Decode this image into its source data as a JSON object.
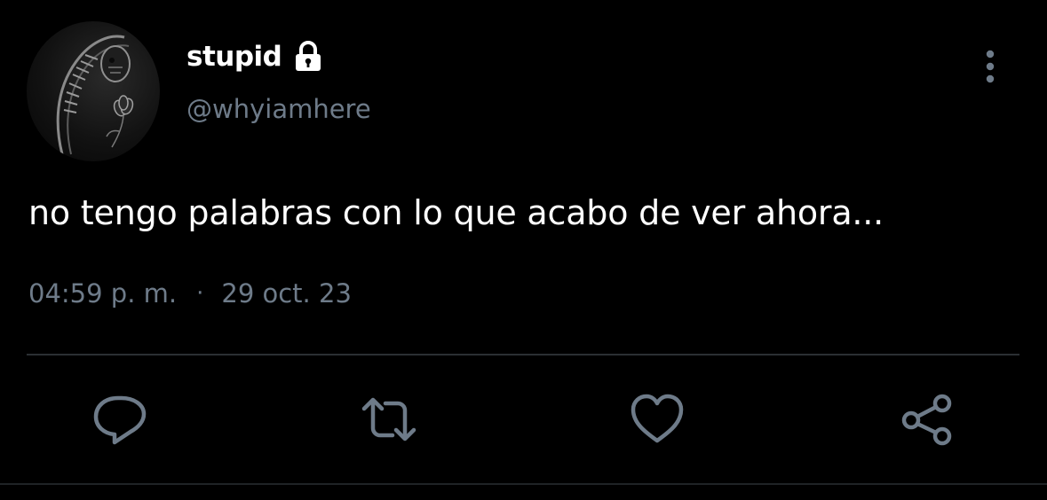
{
  "author": {
    "display_name": "stupid",
    "handle": "@whyiamhere",
    "protected_icon": "lock-icon",
    "avatar_icon": "skeleton-flower-illustration"
  },
  "tweet": {
    "text": "no tengo palabras con lo que acabo de ver ahora...",
    "time": "04:59 p. m.",
    "separator": "·",
    "date": "29 oct. 23"
  },
  "menu_icon": "more-vertical-icon",
  "actions": [
    {
      "id": "reply",
      "icon": "reply-icon"
    },
    {
      "id": "retweet",
      "icon": "retweet-icon"
    },
    {
      "id": "like",
      "icon": "heart-icon"
    },
    {
      "id": "share",
      "icon": "share-icon"
    }
  ],
  "colors": {
    "background": "#000000",
    "primary_text": "#ffffff",
    "secondary_text": "#6e7b89",
    "divider": "#2b2f33"
  }
}
